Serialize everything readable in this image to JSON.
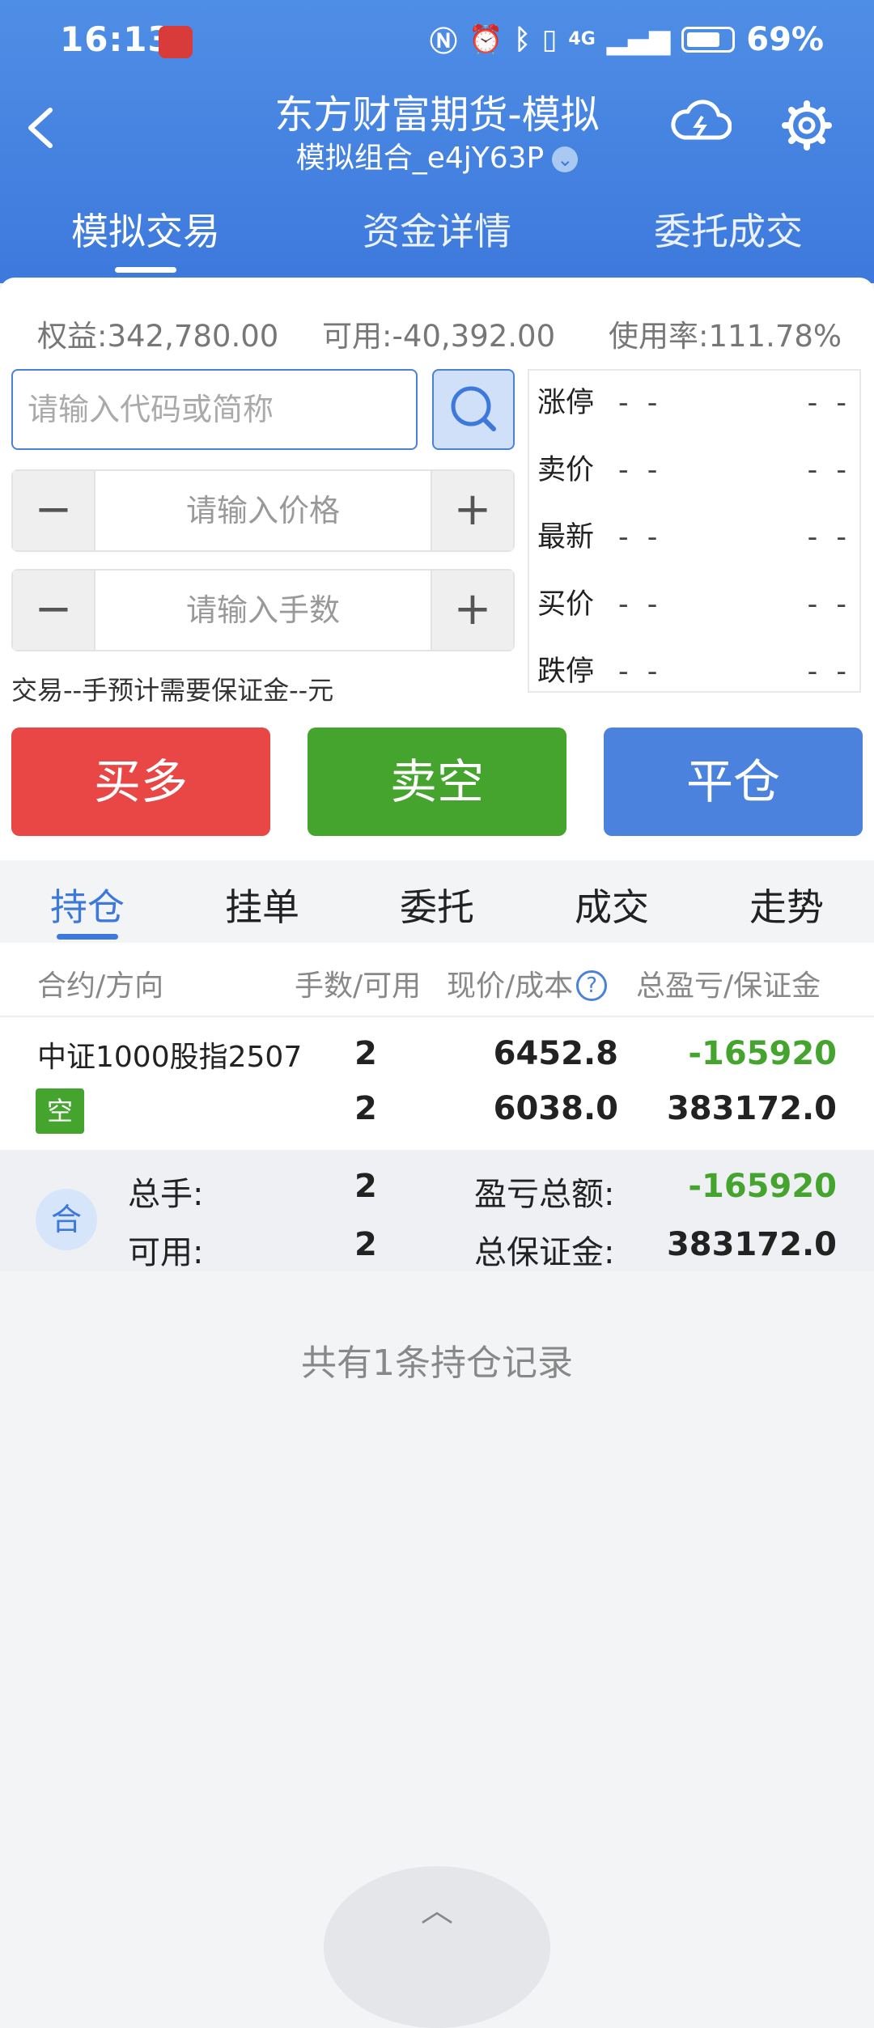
{
  "status_bar": {
    "time": "16:13",
    "battery": "69%",
    "network": "4G"
  },
  "header": {
    "title": "东方财富期货-模拟",
    "subtitle": "模拟组合_e4jY63P"
  },
  "top_tabs": [
    "模拟交易",
    "资金详情",
    "委托成交"
  ],
  "summary": {
    "equity": "权益:342,780.00",
    "available": "可用:-40,392.00",
    "usage": "使用率:111.78%"
  },
  "search": {
    "placeholder": "请输入代码或简称"
  },
  "price_input": {
    "placeholder": "请输入价格",
    "minus": "−",
    "plus": "+"
  },
  "qty_input": {
    "placeholder": "请输入手数",
    "minus": "−",
    "plus": "+"
  },
  "note": "交易--手预计需要保证金--元",
  "quote": {
    "rows": [
      {
        "label": "涨停",
        "v1": "- -",
        "v2": "- -"
      },
      {
        "label": "卖价",
        "v1": "- -",
        "v2": "- -"
      },
      {
        "label": "最新",
        "v1": "- -",
        "v2": "- -"
      },
      {
        "label": "买价",
        "v1": "- -",
        "v2": "- -"
      },
      {
        "label": "跌停",
        "v1": "- -",
        "v2": "- -"
      }
    ]
  },
  "actions": {
    "buy": "买多",
    "sell": "卖空",
    "close": "平仓"
  },
  "sub_tabs": [
    "持仓",
    "挂单",
    "委托",
    "成交",
    "走势"
  ],
  "table_headers": {
    "contract": "合约/方向",
    "qty": "手数/可用",
    "price": "现价/成本",
    "help": "?",
    "pnl": "总盈亏/保证金"
  },
  "position": {
    "name": "中证1000股指2507",
    "direction": "空",
    "qty": "2",
    "available": "2",
    "price": "6452.8",
    "cost": "6038.0",
    "pnl": "-165920",
    "margin": "383172.0"
  },
  "totals": {
    "badge": "合",
    "total_qty_label": "总手:",
    "total_qty": "2",
    "available_label": "可用:",
    "available": "2",
    "pnl_label": "盈亏总额:",
    "pnl": "-165920",
    "margin_label": "总保证金:",
    "margin": "383172.0"
  },
  "footer_text": "共有1条持仓记录",
  "colors": {
    "primary": "#3d79dc",
    "buy": "#e84745",
    "sell": "#44a42e",
    "close": "#4a82dd",
    "loss": "#44a42e"
  }
}
